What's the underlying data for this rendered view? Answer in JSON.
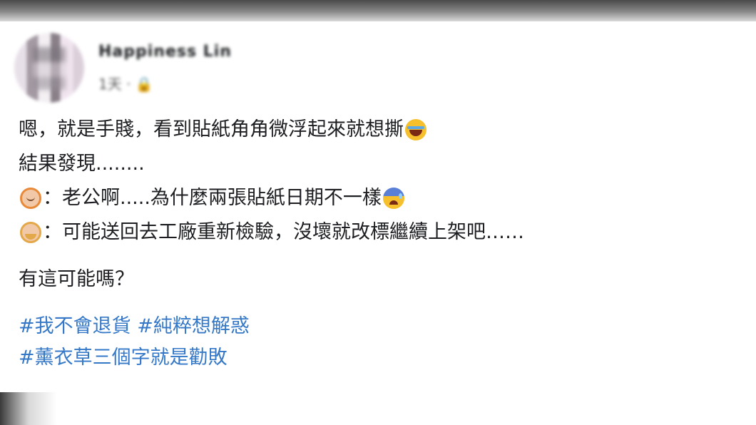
{
  "author": {
    "name": "Happiness Lin",
    "meta": "1天 · 🔒"
  },
  "post": {
    "line1_text": "嗯，就是手賤，看到貼紙角角微浮起來就想撕",
    "line1_emoji": "tears-of-joy-emoji",
    "line2_text": "結果發現........",
    "line3_speaker_emoji": "woman-emoji",
    "line3_text": "：老公啊.....為什麼兩張貼紙日期不一樣",
    "line3_end_emoji": "anxious-sweat-emoji",
    "line4_speaker_emoji": "man-emoji",
    "line4_text": "：可能送回去工廠重新檢驗，沒壞就改標繼續上架吧……",
    "question": "有這可能嗎？"
  },
  "hashtags": {
    "tag1": "#我不會退貨",
    "tag2": "#純粹想解惑",
    "tag3": "#薰衣草三個字就是勸敗"
  },
  "colors": {
    "text": "#1c1e21",
    "hashtag": "#3578c8"
  }
}
